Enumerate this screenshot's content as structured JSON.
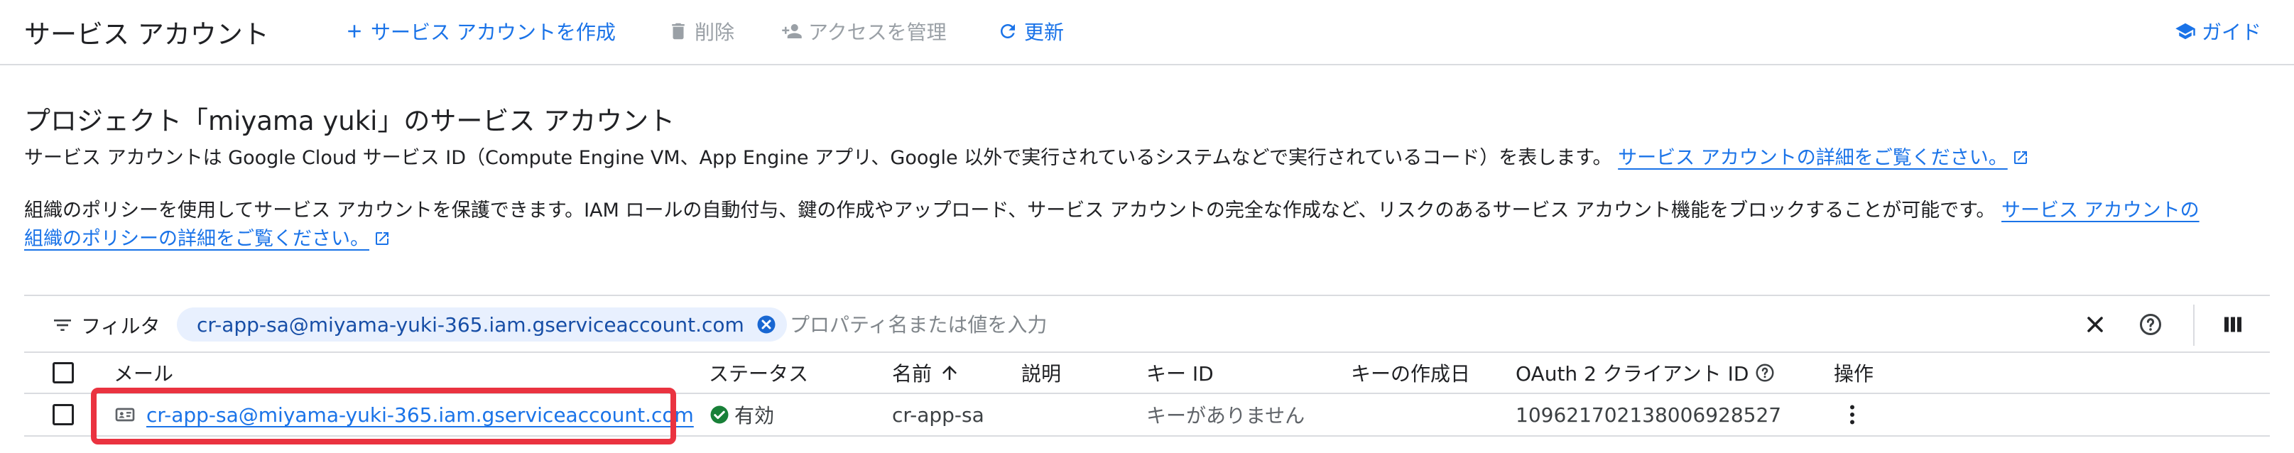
{
  "header": {
    "title": "サービス アカウント",
    "create_label": "サービス アカウントを作成",
    "delete_label": "削除",
    "manage_access_label": "アクセスを管理",
    "refresh_label": "更新",
    "guide_label": "ガイド"
  },
  "section": {
    "title": "プロジェクト「miyama yuki」のサービス アカウント",
    "desc1_text": "サービス アカウントは Google Cloud サービス ID（Compute Engine VM、App Engine アプリ、Google 以外で実行されているシステムなどで実行されているコード）を表します。",
    "desc1_link": "サービス アカウントの詳細をご覧ください。",
    "desc2_text": "組織のポリシーを使用してサービス アカウントを保護できます。IAM ロールの自動付与、鍵の作成やアップロード、サービス アカウントの完全な作成など、リスクのあるサービス アカウント機能をブロックすることが可能です。",
    "desc2_link_part1": "サービス アカウントの",
    "desc2_link_part2": "組織のポリシーの詳細をご覧ください。"
  },
  "filter": {
    "label": "フィルタ",
    "chip_value": "cr-app-sa@miyama-yuki-365.iam.gserviceaccount.com",
    "placeholder": "プロパティ名または値を入力"
  },
  "table": {
    "columns": {
      "email": "メール",
      "status": "ステータス",
      "name": "名前",
      "description": "説明",
      "key_id": "キー ID",
      "key_created": "キーの作成日",
      "oauth_client_id": "OAuth 2 クライアント ID",
      "actions": "操作"
    },
    "rows": [
      {
        "email": "cr-app-sa@miyama-yuki-365.iam.gserviceaccount.com",
        "status": "有効",
        "name": "cr-app-sa",
        "description": "",
        "key_id": "キーがありません",
        "key_created": "",
        "oauth_client_id": "109621702138006928527"
      }
    ]
  },
  "colors": {
    "accent": "#1a73e8",
    "status_ok": "#188038",
    "highlight": "#ea3340",
    "disabled": "#9aa0a6"
  }
}
